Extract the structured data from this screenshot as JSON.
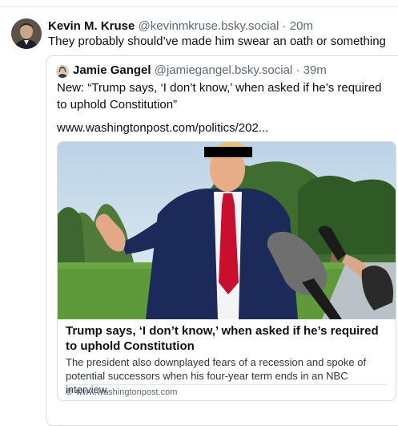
{
  "post": {
    "author_name": "Kevin M. Kruse",
    "author_handle": "@kevinmkruse.bsky.social",
    "separator": " · ",
    "time": "20m",
    "text": "They probably should’ve made him swear an oath or something"
  },
  "quote": {
    "author_name": "Jamie Gangel",
    "author_handle": "@jamiegangel.bsky.social",
    "separator": " · ",
    "time": "39m",
    "text": "New: “Trump says, ‘I don’t know,’ when asked if he’s required to uphold Constitution”",
    "link_text": "www.washingtonpost.com/politics/202..."
  },
  "embed": {
    "title": "Trump says, ‘I don’t know,’ when asked if he’s required to uphold Constitution",
    "description": "The president also downplayed fears of a recession and spoke of potential successors when his four-year term ends in an NBC interview.",
    "domain": "www.washingtonpost.com",
    "domain_icon": "globe-icon"
  },
  "colors": {
    "text_primary": "#0b0f14",
    "text_secondary": "#5b6978",
    "border": "#d4dbe2",
    "tie_red": "#c8102e",
    "suit_navy": "#1c2a5a"
  }
}
